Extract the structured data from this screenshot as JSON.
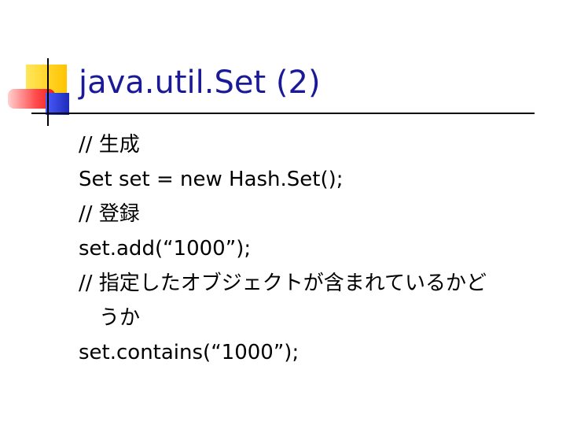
{
  "slide": {
    "title": "java.util.Set (2)",
    "lines": [
      {
        "text": "// 生成"
      },
      {
        "text": "Set set = new Hash.Set();"
      },
      {
        "text": "// 登録"
      },
      {
        "text": "set.add(“1000”);"
      },
      {
        "text": "// 指定したオブジェクトが含まれているかど"
      },
      {
        "text": "うか"
      },
      {
        "text": "set.contains(“1000”);"
      }
    ]
  },
  "colors": {
    "title": "#1a1a99",
    "logo_yellow": "#ffd21f",
    "logo_red": "#ff3b3b",
    "logo_blue": "#2b3fd6"
  }
}
